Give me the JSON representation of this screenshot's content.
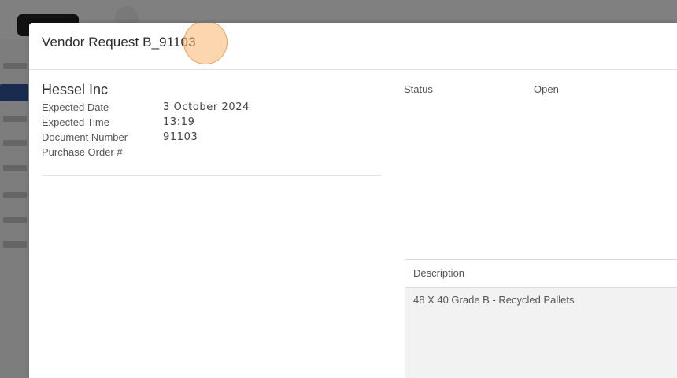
{
  "modal": {
    "title": "Vendor Request B_91103"
  },
  "vendor": {
    "name": "Hessel Inc",
    "fields": [
      {
        "label": "Expected Date",
        "value": "3 October 2024"
      },
      {
        "label": "Expected Time",
        "value": "13:19"
      },
      {
        "label": "Document Number",
        "value": "91103"
      },
      {
        "label": "Purchase Order #",
        "value": ""
      }
    ]
  },
  "status": {
    "label": "Status",
    "value": "Open"
  },
  "description": {
    "header": "Description",
    "text": "48 X 40 Grade B - Recycled Pallets"
  },
  "colors": {
    "accent": "#2f4f8f",
    "click_marker": "#fab46e"
  }
}
